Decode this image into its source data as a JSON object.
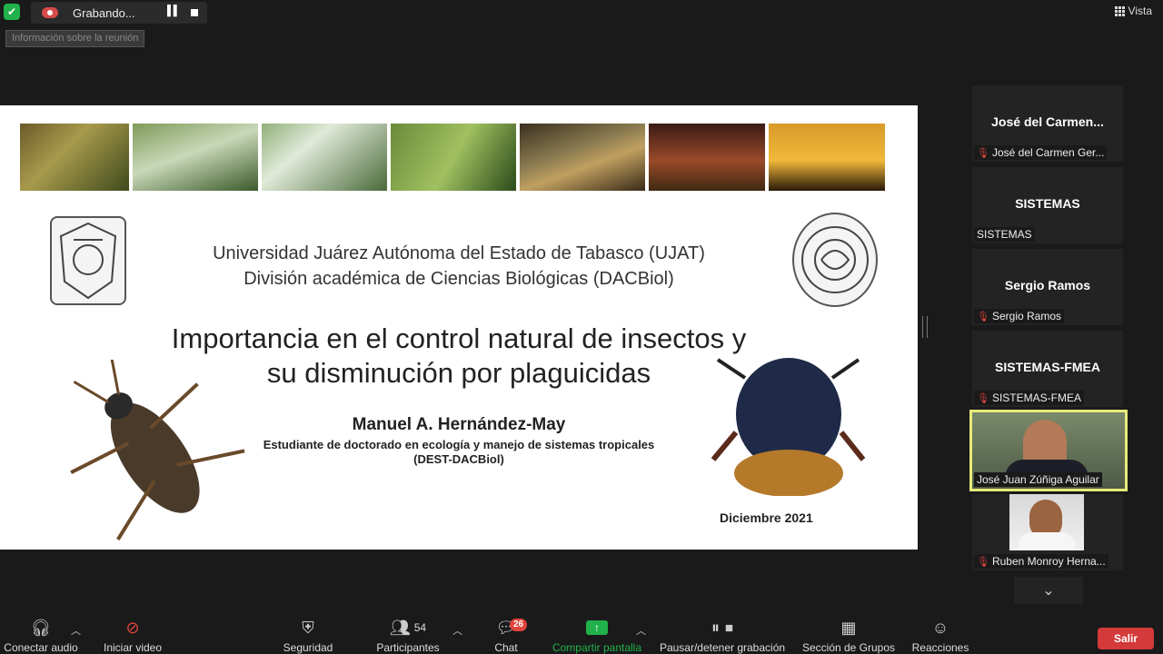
{
  "topbar": {
    "recording_label": "Grabando...",
    "meeting_info": "Información sobre la reunión",
    "view_label": "Vista"
  },
  "slide": {
    "university": "Universidad Juárez Autónoma del Estado de Tabasco (UJAT)",
    "division": "División académica de Ciencias Biológicas (DACBiol)",
    "title_line1": "Importancia en el control natural de insectos y",
    "title_line2": "su disminución por plaguicidas",
    "author": "Manuel A. Hernández-May",
    "role_line1": "Estudiante de doctorado en ecología y manejo de sistemas tropicales",
    "role_line2": "(DEST-DACBiol)",
    "date": "Diciembre 2021"
  },
  "participants": [
    {
      "name": "José del Carmen...",
      "label": "José del Carmen Ger...",
      "muted": true
    },
    {
      "name": "SISTEMAS",
      "label": "SISTEMAS",
      "muted": false
    },
    {
      "name": "Sergio Ramos",
      "label": "Sergio Ramos",
      "muted": true
    },
    {
      "name": "SISTEMAS-FMEA",
      "label": "SISTEMAS-FMEA",
      "muted": true
    },
    {
      "label": "José  Juan Zúñiga Aguilar",
      "muted": false,
      "active_speaker": true
    },
    {
      "label": "Ruben Monroy Herna...",
      "muted": true
    }
  ],
  "toolbar": {
    "audio": "Conectar audio",
    "video": "Iniciar video",
    "security": "Seguridad",
    "participants": "Participantes",
    "participants_count": "54",
    "chat": "Chat",
    "chat_badge": "26",
    "share": "Compartir pantalla",
    "record": "Pausar/detener grabación",
    "breakout": "Sección de Grupos",
    "reactions": "Reacciones",
    "leave": "Salir"
  },
  "colors": {
    "accent_green": "#20b14b",
    "leave_red": "#d43a3a",
    "active_speaker_border": "#e6eb7a"
  }
}
